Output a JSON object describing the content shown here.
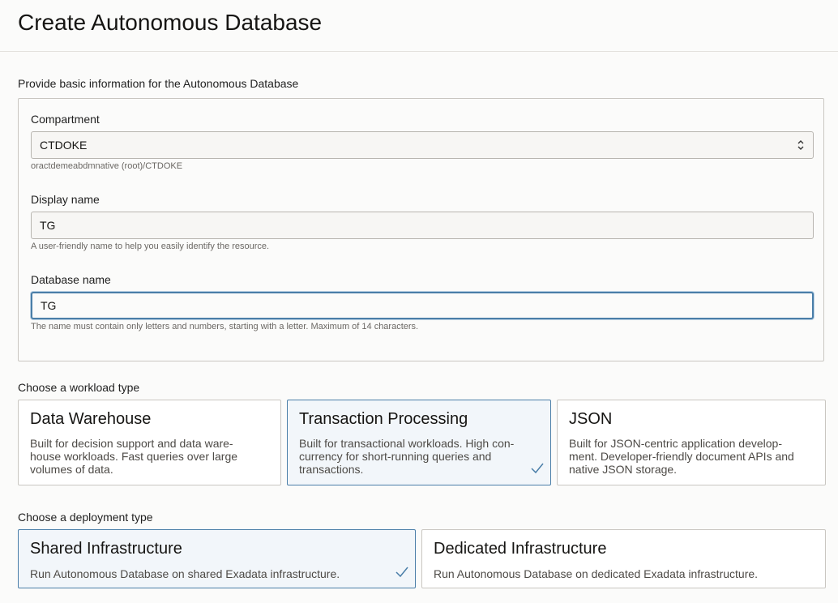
{
  "header": {
    "title": "Create Autonomous Database"
  },
  "basic_info": {
    "section_label": "Provide basic information for the Autonomous Database",
    "compartment": {
      "label": "Compartment",
      "value": "CTDOKE",
      "help": "oractdemeabdmnative (root)/CTDOKE"
    },
    "display_name": {
      "label": "Display name",
      "value": "TG",
      "help": "A user-friendly name to help you easily identify the resource."
    },
    "database_name": {
      "label": "Database name",
      "value": "TG",
      "help": "The name must contain only letters and numbers, starting with a letter. Maximum of 14 characters."
    }
  },
  "workload": {
    "section_label": "Choose a workload type",
    "options": [
      {
        "title": "Data Warehouse",
        "desc_lines": [
          "Built for decision support and data ware-",
          "house workloads. Fast queries over large",
          "volumes of data."
        ],
        "selected": false
      },
      {
        "title": "Transaction Processing",
        "desc_lines": [
          "Built for transactional workloads. High con-",
          "currency for short-running queries and",
          "transactions."
        ],
        "selected": true
      },
      {
        "title": "JSON",
        "desc_lines": [
          "Built for JSON-centric application develop-",
          "ment. Developer-friendly document APIs and",
          "native JSON storage."
        ],
        "selected": false
      }
    ]
  },
  "deployment": {
    "section_label": "Choose a deployment type",
    "options": [
      {
        "title": "Shared Infrastructure",
        "desc": "Run Autonomous Database on shared Exadata infrastructure.",
        "selected": true
      },
      {
        "title": "Dedicated Infrastructure",
        "desc": "Run Autonomous Database on dedicated Exadata infrastructure.",
        "selected": false
      }
    ]
  },
  "colors": {
    "accent": "#4a7ea8",
    "selected_bg": "#f2f6fa",
    "border": "#c9c6c1"
  }
}
